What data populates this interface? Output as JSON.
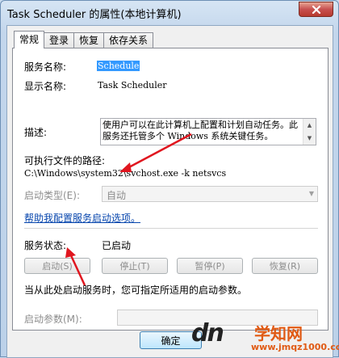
{
  "window": {
    "title": "Task Scheduler 的属性(本地计算机)"
  },
  "tabs": [
    {
      "label": "常规",
      "active": true
    },
    {
      "label": "登录",
      "active": false
    },
    {
      "label": "恢复",
      "active": false
    },
    {
      "label": "依存关系",
      "active": false
    }
  ],
  "general": {
    "service_name_label": "服务名称:",
    "service_name_value": "Schedule",
    "display_name_label": "显示名称:",
    "display_name_value": "Task Scheduler",
    "description_label": "描述:",
    "description_value": "使用户可以在此计算机上配置和计划自动任务。此服务还托管多个 Windows 系统关键任务。",
    "exe_path_label": "可执行文件的路径:",
    "exe_path_value": "C:\\Windows\\system32\\svchost.exe -k netsvcs",
    "startup_type_label": "启动类型(E):",
    "startup_type_value": "自动",
    "help_link": "帮助我配置服务启动选项。",
    "service_status_label": "服务状态:",
    "service_status_value": "已启动",
    "buttons": {
      "start": "启动(S)",
      "stop": "停止(T)",
      "pause": "暂停(P)",
      "resume": "恢复(R)"
    },
    "start_hint": "当从此处启动服务时，您可指定所适用的启动参数。",
    "start_params_label": "启动参数(M):",
    "start_params_value": ""
  },
  "footer": {
    "ok_label": "确定"
  },
  "watermark": {
    "logo": "dn",
    "brand": "学知网",
    "url": "www.jmqz1000.com"
  },
  "colors": {
    "annotation_arrow": "#e0161f",
    "selection": "#3399ff",
    "link": "#0645ad"
  },
  "icons": {
    "close": "close-icon",
    "dropdown": "chevron-down-icon"
  }
}
